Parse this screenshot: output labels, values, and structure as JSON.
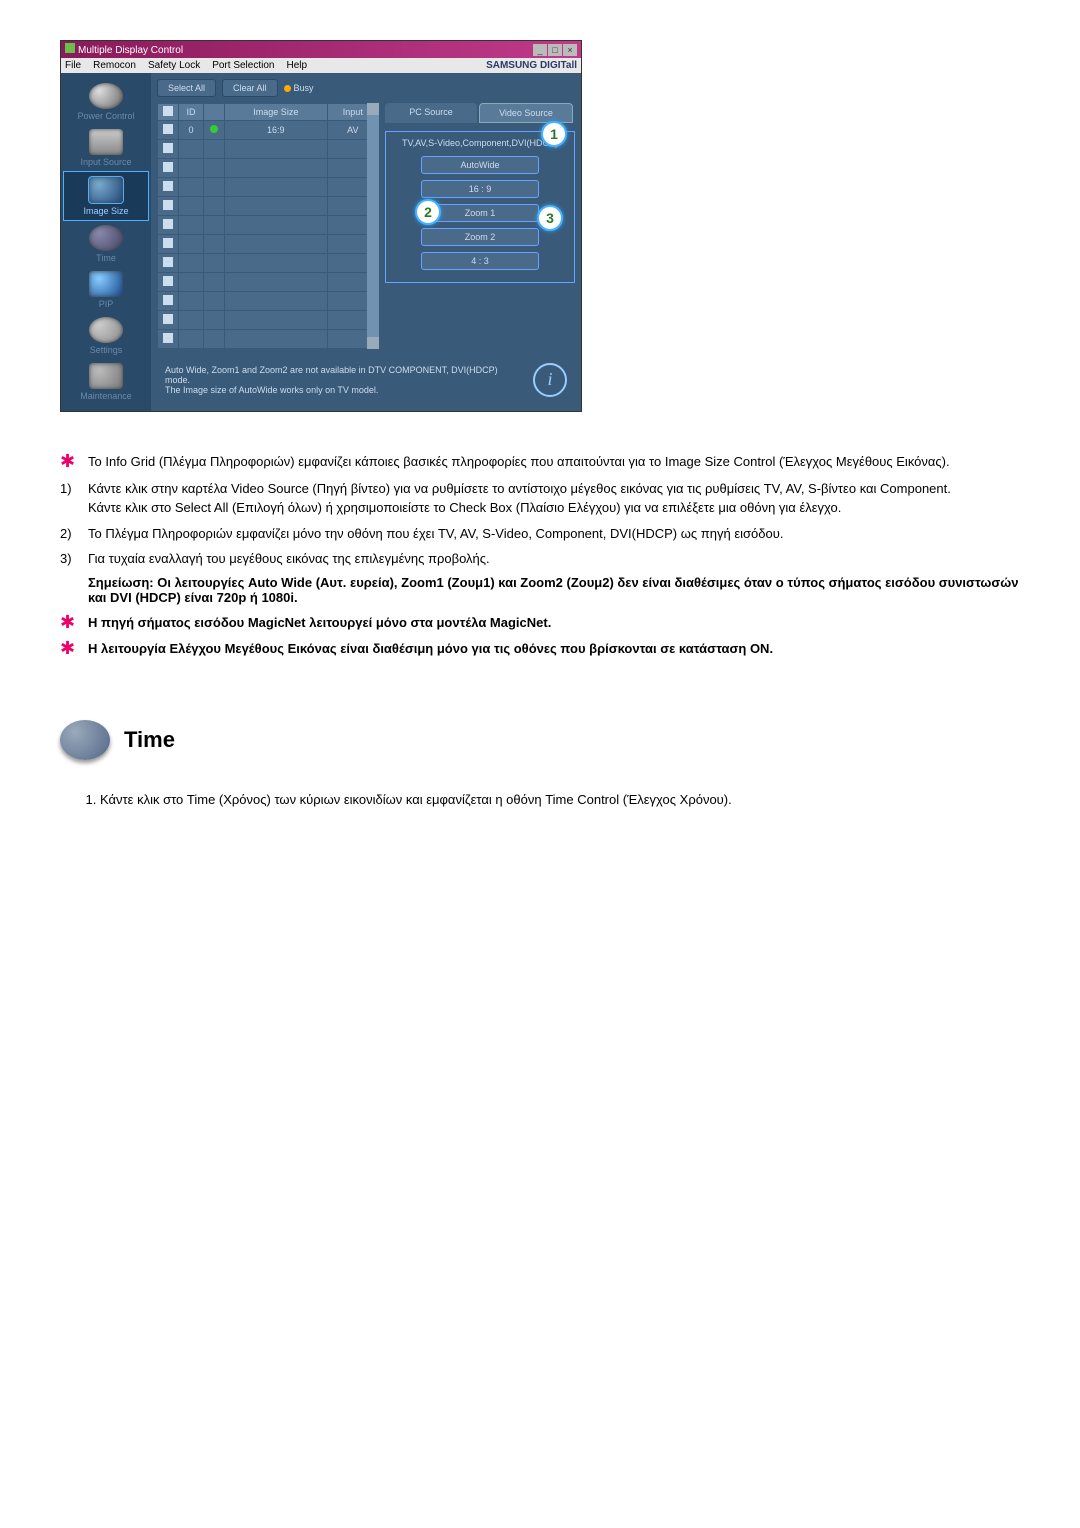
{
  "app": {
    "title": "Multiple Display Control",
    "menus": [
      "File",
      "Remocon",
      "Safety Lock",
      "Port Selection",
      "Help"
    ],
    "brand": "SAMSUNG DIGITall",
    "sidebar": [
      {
        "label": "Power Control",
        "icon": "power"
      },
      {
        "label": "Input Source",
        "icon": "input"
      },
      {
        "label": "Image Size",
        "icon": "imgsize",
        "active": true
      },
      {
        "label": "Time",
        "icon": "time"
      },
      {
        "label": "PIP",
        "icon": "pip"
      },
      {
        "label": "Settings",
        "icon": "settings"
      },
      {
        "label": "Maintenance",
        "icon": "maint"
      }
    ],
    "selectAll": "Select All",
    "clearAll": "Clear All",
    "busy": "Busy",
    "grid": {
      "headers": [
        "",
        "ID",
        "",
        "Image Size",
        "Input"
      ],
      "row": {
        "id": "0",
        "size": "16:9",
        "input": "AV"
      }
    },
    "tabs": {
      "pc": "PC Source",
      "video": "Video Source"
    },
    "panelLabel": "TV,AV,S-Video,Component,DVI(HDCP)",
    "sizeButtons": [
      "AutoWide",
      "16 : 9",
      "Zoom 1",
      "Zoom 2",
      "4 : 3"
    ],
    "footer1": "Auto Wide, Zoom1 and Zoom2 are not available in DTV COMPONENT, DVI(HDCP) mode.",
    "footer2": "The Image size of AutoWide works only on TV model.",
    "callouts": [
      "1",
      "2",
      "3"
    ]
  },
  "doc": {
    "p_star1": "Το Info Grid (Πλέγμα Πληροφοριών) εμφανίζει κάποιες βασικές πληροφορίες που απαιτούνται για το Image Size Control (Έλεγχος Μεγέθους Εικόνας).",
    "p1a": "Κάντε κλικ στην καρτέλα Video Source (Πηγή βίντεο) για να ρυθμίσετε το αντίστοιχο μέγεθος εικόνας για τις ρυθμίσεις TV, AV, S-βίντεο και Component.",
    "p1b": "Κάντε κλικ στο Select All (Επιλογή όλων) ή χρησιμοποιείστε το Check Box (Πλαίσιο Ελέγχου) για να επιλέξετε μια οθόνη για έλεγχο.",
    "p2": "Το Πλέγμα Πληροφοριών εμφανίζει μόνο την οθόνη που έχει TV, AV, S-Video, Component, DVI(HDCP) ως πηγή εισόδου.",
    "p3": "Για τυχαία εναλλαγή του μεγέθους εικόνας της επιλεγμένης προβολής.",
    "note": "Σημείωση: Οι λειτουργίες Auto Wide (Αυτ. ευρεία), Zoom1 (Ζουμ1) και Zoom2 (Ζουμ2) δεν είναι διαθέσιμες όταν ο τύπος σήματος εισόδου συνιστωσών και DVI (HDCP) είναι 720p ή 1080i.",
    "star2": "Η πηγή σήματος εισόδου MagicNet λειτουργεί μόνο στα μοντέλα MagicNet.",
    "star3": "Η λειτουργία Ελέγχου Μεγέθους Εικόνας είναι διαθέσιμη μόνο για τις οθόνες που βρίσκονται σε κατάσταση ON.",
    "timeTitle": "Time",
    "timeItem1": "Κάντε κλικ στο Time (Χρόνος) των κύριων εικονιδίων και εμφανίζεται η οθόνη Time Control (Έλεγχος Χρόνου)."
  }
}
